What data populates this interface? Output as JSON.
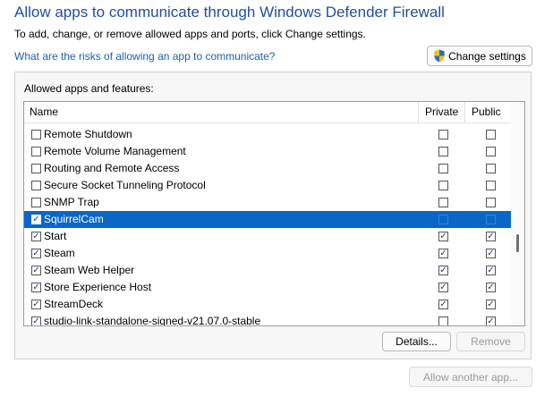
{
  "window": {
    "title": "Allow apps to communicate through Windows Defender Firewall",
    "subtitle": "To add, change, or remove allowed apps and ports, click Change settings.",
    "risk_link": "What are the risks of allowing an app to communicate?",
    "change_settings": "Change settings"
  },
  "group": {
    "label": "Allowed apps and features:",
    "columns": {
      "name": "Name",
      "private": "Private",
      "public": "Public"
    },
    "rows": [
      {
        "name": "Remote Shutdown",
        "enabled": false,
        "private": false,
        "public": false,
        "selected": false
      },
      {
        "name": "Remote Volume Management",
        "enabled": false,
        "private": false,
        "public": false,
        "selected": false
      },
      {
        "name": "Routing and Remote Access",
        "enabled": false,
        "private": false,
        "public": false,
        "selected": false
      },
      {
        "name": "Secure Socket Tunneling Protocol",
        "enabled": false,
        "private": false,
        "public": false,
        "selected": false
      },
      {
        "name": "SNMP Trap",
        "enabled": false,
        "private": false,
        "public": false,
        "selected": false
      },
      {
        "name": "SquirrelCam",
        "enabled": true,
        "private": false,
        "public": false,
        "selected": true
      },
      {
        "name": "Start",
        "enabled": true,
        "private": true,
        "public": true,
        "selected": false
      },
      {
        "name": "Steam",
        "enabled": true,
        "private": true,
        "public": true,
        "selected": false
      },
      {
        "name": "Steam Web Helper",
        "enabled": true,
        "private": true,
        "public": true,
        "selected": false
      },
      {
        "name": "Store Experience Host",
        "enabled": true,
        "private": true,
        "public": true,
        "selected": false
      },
      {
        "name": "StreamDeck",
        "enabled": true,
        "private": true,
        "public": true,
        "selected": false
      },
      {
        "name": "studio-link-standalone-signed-v21.07.0-stable",
        "enabled": true,
        "private": false,
        "public": true,
        "selected": false
      }
    ],
    "details": "Details...",
    "remove": "Remove"
  },
  "allow_another": "Allow another app...",
  "icons": {
    "shield": "uac-shield-icon",
    "check": "checkmark-icon"
  },
  "colors": {
    "title": "#1f4e9c",
    "link": "#1a5fb4",
    "selection": "#0a66c8"
  }
}
